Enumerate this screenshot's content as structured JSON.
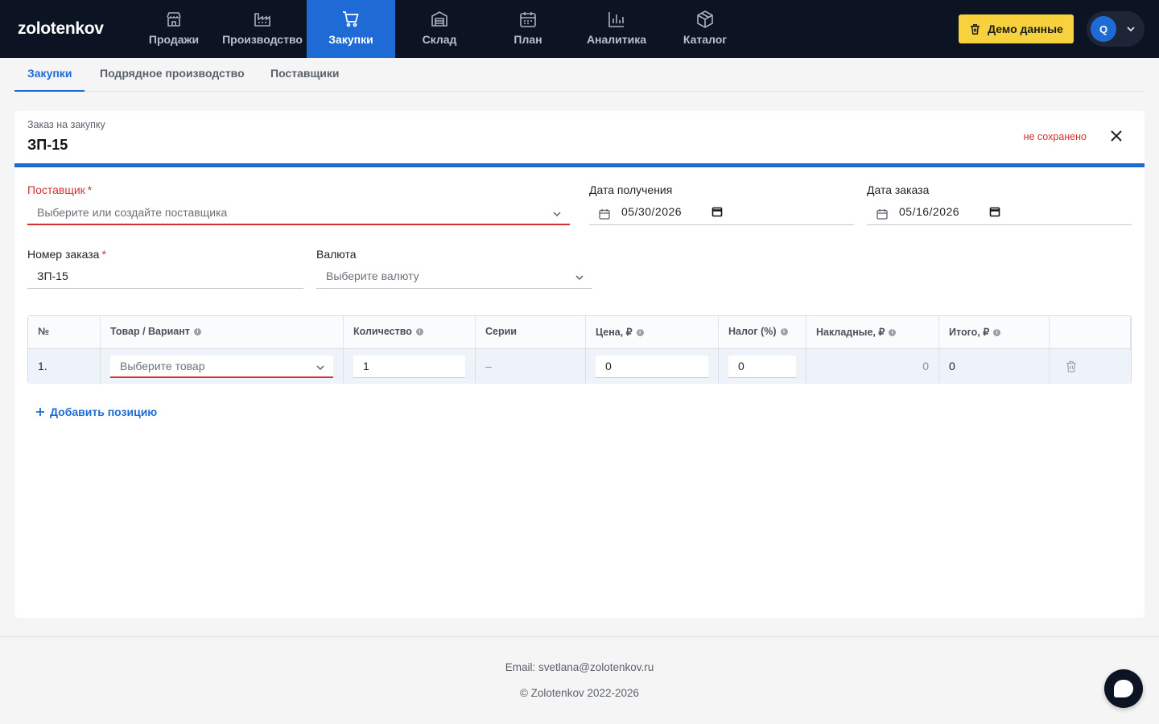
{
  "app": {
    "logo": "zolotenkov"
  },
  "nav": [
    {
      "label": "Продажи",
      "icon": "store-icon"
    },
    {
      "label": "Производство",
      "icon": "factory-icon"
    },
    {
      "label": "Закупки",
      "icon": "cart-icon",
      "active": true
    },
    {
      "label": "Склад",
      "icon": "warehouse-icon"
    },
    {
      "label": "План",
      "icon": "calendar-icon"
    },
    {
      "label": "Аналитика",
      "icon": "chart-icon"
    },
    {
      "label": "Каталог",
      "icon": "box-icon"
    }
  ],
  "header": {
    "demo_label": "Демо данные",
    "user_initial": "Q"
  },
  "subtabs": [
    "Закупки",
    "Подрядное производство",
    "Поставщики"
  ],
  "order": {
    "subtitle": "Заказ на закупку",
    "title": "ЗП-15",
    "status": "не сохранено"
  },
  "form": {
    "supplier": {
      "label": "Поставщик",
      "required": "*",
      "placeholder": "Выберите или создайте поставщика"
    },
    "receive_date": {
      "label": "Дата получения",
      "value": "05/30/2026"
    },
    "order_date": {
      "label": "Дата заказа",
      "value": "05/16/2026"
    },
    "order_number": {
      "label": "Номер заказа",
      "required": "*",
      "value": "ЗП-15"
    },
    "currency": {
      "label": "Валюта",
      "placeholder": "Выберите валюту"
    }
  },
  "table": {
    "headers": [
      "№",
      "Товар / Вариант",
      "Количество",
      "Серии",
      "Цена, ₽",
      "Налог (%)",
      "Накладные, ₽",
      "Итого, ₽"
    ],
    "info_mark": "i",
    "rows": [
      {
        "num": "1.",
        "product_placeholder": "Выберите товар",
        "quantity": "1",
        "series": "–",
        "price": "0",
        "tax": "0",
        "overhead": "0",
        "total": "0"
      }
    ]
  },
  "add_position": "Добавить позицию",
  "footer": {
    "email": "Email: svetlana@zolotenkov.ru",
    "copyright": "© Zolotenkov 2022-2026"
  },
  "colors": {
    "accent": "#1e6bd6",
    "topbar": "#0c1424",
    "error": "#d32f2f",
    "demo": "#f7d23e"
  }
}
